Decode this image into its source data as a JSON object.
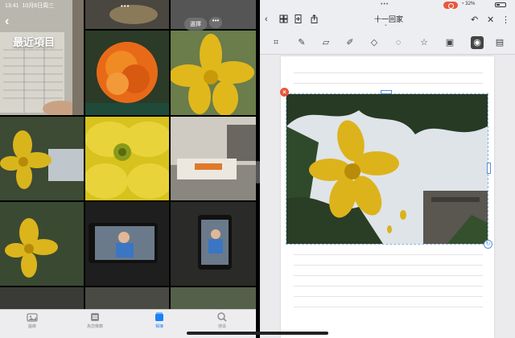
{
  "status": {
    "time": "13:41",
    "date": "10月6日周三",
    "battery": "32%"
  },
  "photos": {
    "album_title": "最近項目",
    "select_label": "選擇",
    "more_label": "•••",
    "tabs": [
      {
        "label": "圖庫",
        "icon": "photo-library-icon",
        "active": false
      },
      {
        "label": "為您推薦",
        "icon": "for-you-icon",
        "active": false
      },
      {
        "label": "相簿",
        "icon": "albums-icon",
        "active": true
      },
      {
        "label": "搜尋",
        "icon": "search-icon",
        "active": false
      }
    ]
  },
  "notes": {
    "doc_title": "十一回家",
    "tools": [
      "lasso-icon",
      "pen-icon",
      "eraser-icon",
      "highlighter-icon",
      "shape-icon",
      "lasso-select-icon",
      "sticker-icon",
      "image-icon",
      "camera-icon",
      "text-icon"
    ]
  },
  "colors": {
    "accent": "#1a82f7",
    "record": "#e8573d",
    "selection": "#5a8fd6"
  }
}
